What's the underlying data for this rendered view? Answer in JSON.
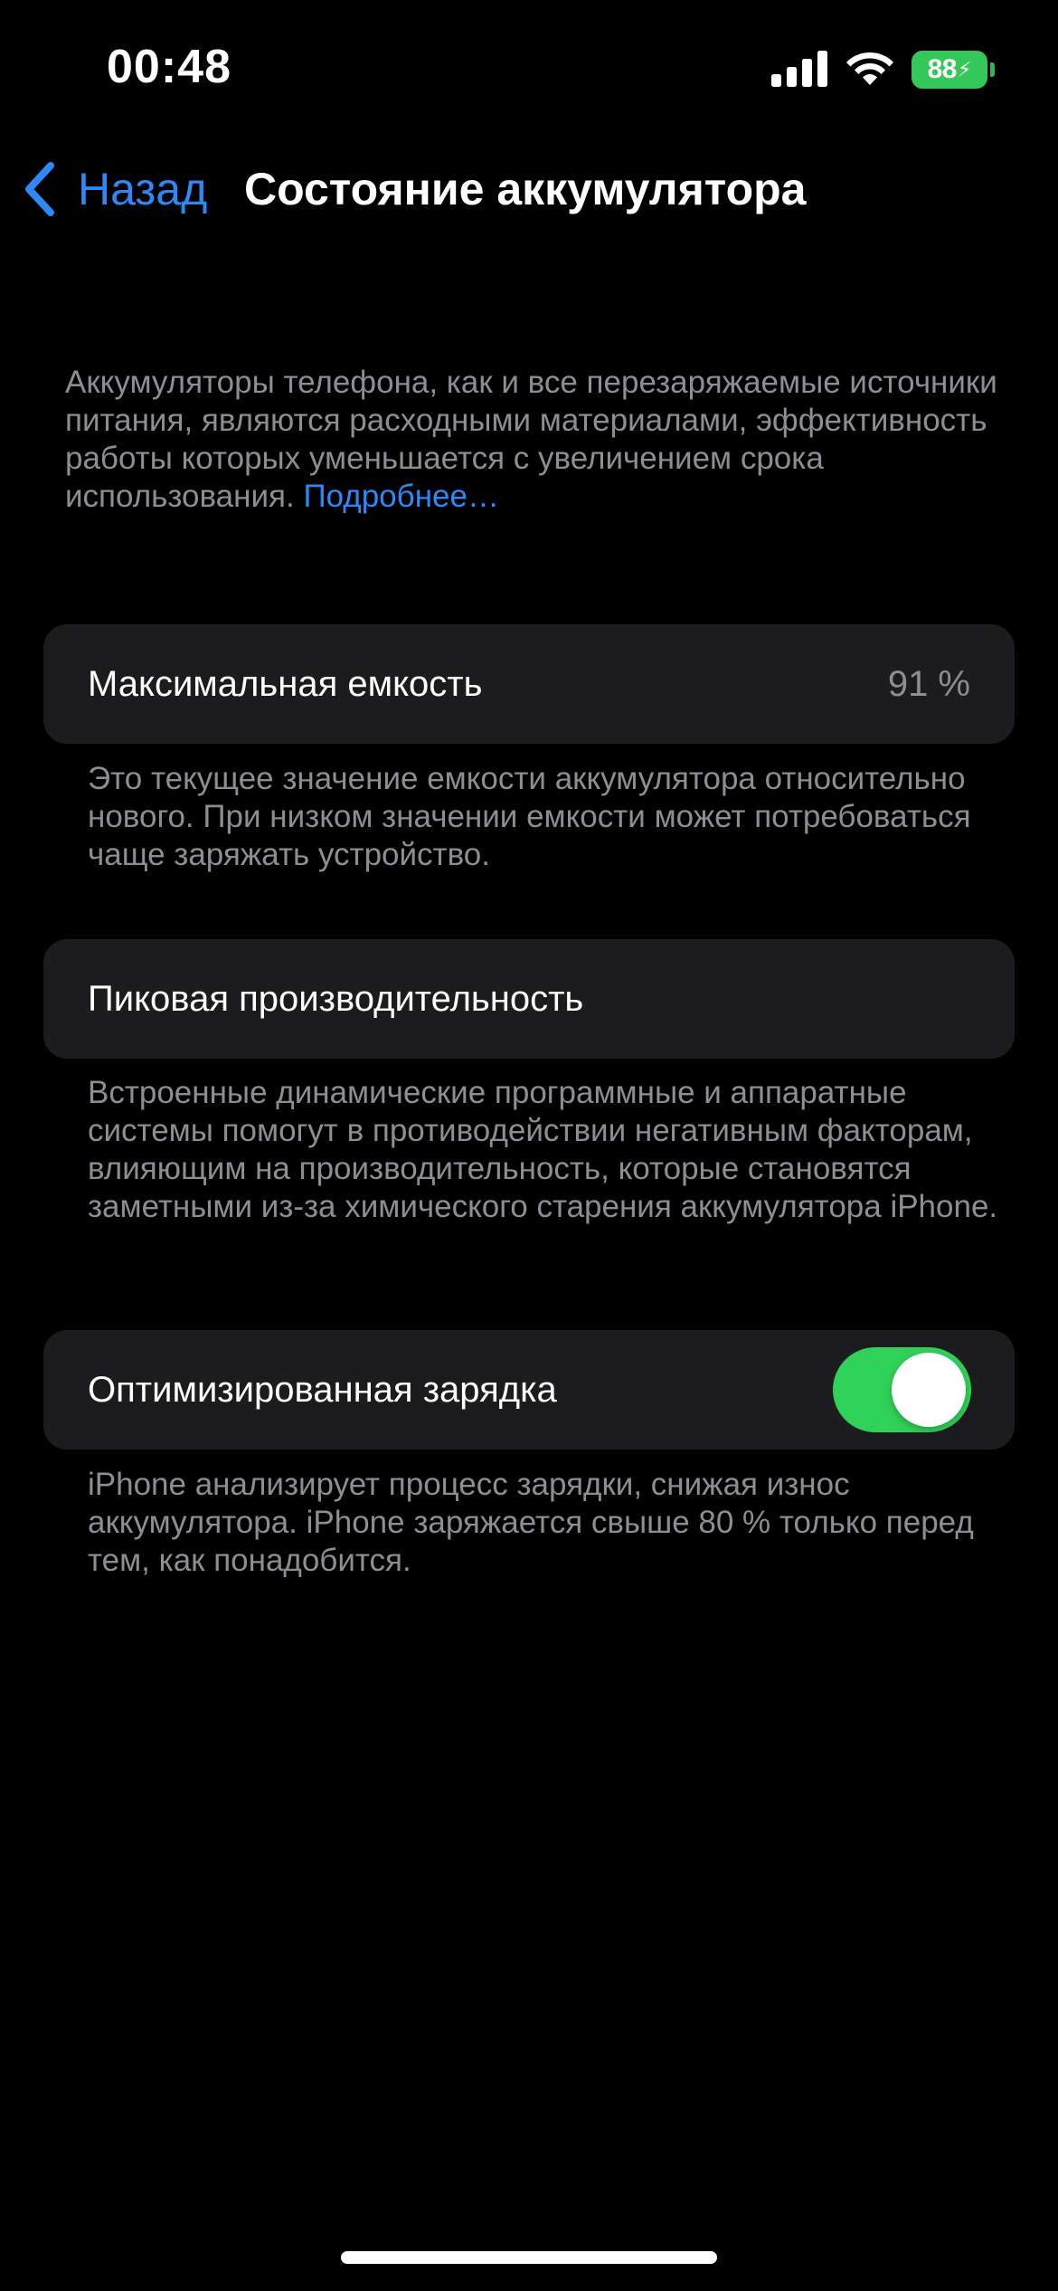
{
  "status_bar": {
    "time": "00:48",
    "battery_level": "88",
    "battery_charging": true,
    "icons": [
      "cellular-signal-icon",
      "wifi-icon",
      "battery-charging-icon"
    ]
  },
  "nav": {
    "back_label": "Назад",
    "title": "Состояние аккумулятора"
  },
  "intro": {
    "text": "Аккумуляторы телефона, как и все перезаряжаемые источники питания, являются расходными материалами, эффективность работы которых уменьшается с увеличением срока использования.",
    "link": "Подробнее…"
  },
  "maximum_capacity": {
    "label": "Максимальная емкость",
    "value": "91 %",
    "footnote": "Это текущее значение емкости аккумулятора относительно нового. При низком значении емкости может потребоваться чаще заряжать устройство."
  },
  "peak_performance": {
    "label": "Пиковая производительность",
    "footnote": "Встроенные динамические программные и аппаратные системы помогут в противодействии негативным факторам, влияющим на производительность, которые становятся заметными из‑за химического старения аккумулятора iPhone."
  },
  "optimized_charging": {
    "label": "Оптимизированная зарядка",
    "enabled": true,
    "footnote": "iPhone анализирует процесс зарядки, снижая износ аккумулятора. iPhone заряжается свыше 80 % только перед тем, как понадобится."
  },
  "colors": {
    "background": "#000000",
    "card": "#1c1c1e",
    "accent_blue": "#2e88f7",
    "secondary_text": "#8d8d93",
    "toggle_on": "#30d158",
    "battery_green": "#34c759"
  }
}
